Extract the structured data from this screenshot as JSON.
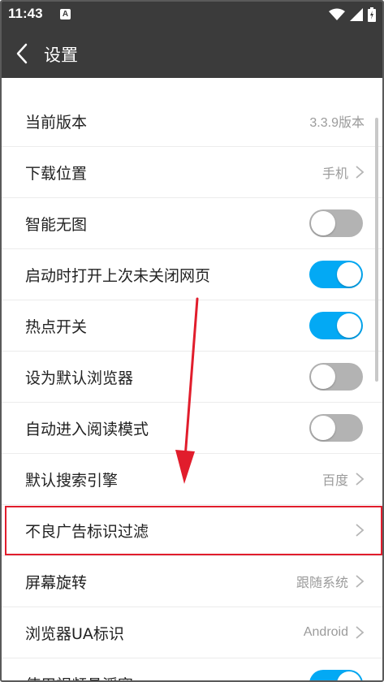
{
  "status": {
    "time": "11:43",
    "badge": "A"
  },
  "header": {
    "title": "设置"
  },
  "settings": [
    {
      "label": "当前版本",
      "type": "value",
      "value": "3.3.9版本"
    },
    {
      "label": "下载位置",
      "type": "link",
      "value": "手机"
    },
    {
      "label": "智能无图",
      "type": "toggle",
      "on": false
    },
    {
      "label": "启动时打开上次未关闭网页",
      "type": "toggle",
      "on": true
    },
    {
      "label": "热点开关",
      "type": "toggle",
      "on": true
    },
    {
      "label": "设为默认浏览器",
      "type": "toggle",
      "on": false
    },
    {
      "label": "自动进入阅读模式",
      "type": "toggle",
      "on": false
    },
    {
      "label": "默认搜索引擎",
      "type": "link",
      "value": "百度"
    },
    {
      "label": "不良广告标识过滤",
      "type": "link",
      "value": ""
    },
    {
      "label": "屏幕旋转",
      "type": "link",
      "value": "跟随系统"
    },
    {
      "label": "浏览器UA标识",
      "type": "link",
      "value": "Android"
    },
    {
      "label": "使用视频悬浮窗",
      "type": "toggle",
      "on": true
    }
  ],
  "colors": {
    "bar": "#3b3b3b",
    "toggle_on": "#03a9f4",
    "toggle_off": "#b3b3b3",
    "highlight": "#e11d2c"
  }
}
